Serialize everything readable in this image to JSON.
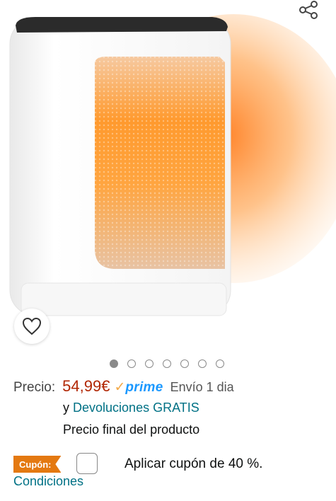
{
  "product": {
    "image_alt": "Calefactor cerámico portátil"
  },
  "gallery": {
    "dot_count": 7,
    "active_index": 0
  },
  "price": {
    "label": "Precio:",
    "value": "54,99€",
    "prime_check": "✓",
    "prime_label": "prime",
    "delivery": "Envío 1 dia",
    "returns_prefix": "y",
    "returns_link": "Devoluciones GRATIS",
    "final_note": "Precio final del producto"
  },
  "coupon": {
    "badge": "Cupón:",
    "checked": false,
    "text": "Aplicar cupón de 40 %."
  },
  "conditions_link": "Condiciones",
  "icons": {
    "share": "share-icon",
    "wishlist": "heart-icon"
  },
  "colors": {
    "price": "#b12704",
    "link": "#007185",
    "prime": "#1a98ff",
    "coupon": "#e47911"
  }
}
